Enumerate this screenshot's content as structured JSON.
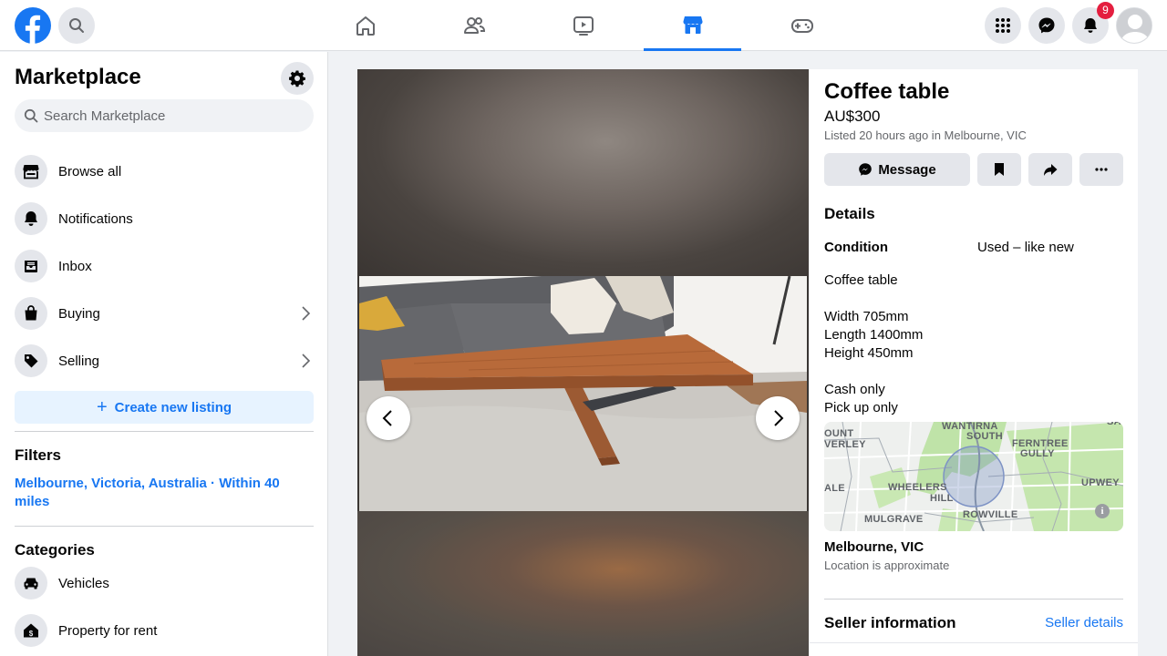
{
  "topbar": {
    "logo": "facebook-logo",
    "search_icon": "search-icon",
    "nav_tabs": [
      {
        "name": "home",
        "icon": "home-icon",
        "active": false
      },
      {
        "name": "friends",
        "icon": "friends-icon",
        "active": false
      },
      {
        "name": "watch",
        "icon": "video-icon",
        "active": false
      },
      {
        "name": "marketplace",
        "icon": "marketplace-icon",
        "active": true
      },
      {
        "name": "gaming",
        "icon": "gamepad-icon",
        "active": false
      }
    ],
    "notification_count": "9",
    "accent": "#1877f2"
  },
  "sidebar": {
    "title": "Marketplace",
    "search_placeholder": "Search Marketplace",
    "items": [
      {
        "label": "Browse all",
        "icon": "storefront-icon"
      },
      {
        "label": "Notifications",
        "icon": "bell-icon"
      },
      {
        "label": "Inbox",
        "icon": "inbox-icon"
      },
      {
        "label": "Buying",
        "icon": "shopping-bag-icon",
        "has_chevron": true
      },
      {
        "label": "Selling",
        "icon": "price-tag-icon",
        "has_chevron": true
      }
    ],
    "create_listing": "Create new listing",
    "filters_heading": "Filters",
    "location_filter": "Melbourne, Victoria, Australia · Within 40 miles",
    "categories_heading": "Categories",
    "categories": [
      {
        "label": "Vehicles",
        "icon": "car-icon"
      },
      {
        "label": "Property for rent",
        "icon": "house-dollar-icon"
      }
    ]
  },
  "listing": {
    "title": "Coffee table",
    "price": "AU$300",
    "listed": "Listed 20 hours ago in Melbourne, VIC",
    "message_label": "Message",
    "details_heading": "Details",
    "condition_label": "Condition",
    "condition_value": "Used – like new",
    "description_lines": [
      "Coffee table",
      "",
      "Width 705mm",
      "Length 1400mm",
      "Height 450mm",
      "",
      "Cash only",
      "Pick up only"
    ],
    "map_labels": {
      "wantirna": "WANTIRNA",
      "south": "SOUTH",
      "ount": "OUNT",
      "verley": "VERLEY",
      "ferntree": "FERNTREE",
      "gully": "GULLY",
      "ale": "ALE",
      "wheelers": "WHEELERS",
      "hill": "HILL",
      "upwey": "UPWEY",
      "mulgrave": "MULGRAVE",
      "rowville": "ROWVILLE",
      "sa": "SA"
    },
    "location_name": "Melbourne, VIC",
    "location_note": "Location is approximate",
    "seller_heading": "Seller information",
    "seller_link": "Seller details"
  }
}
